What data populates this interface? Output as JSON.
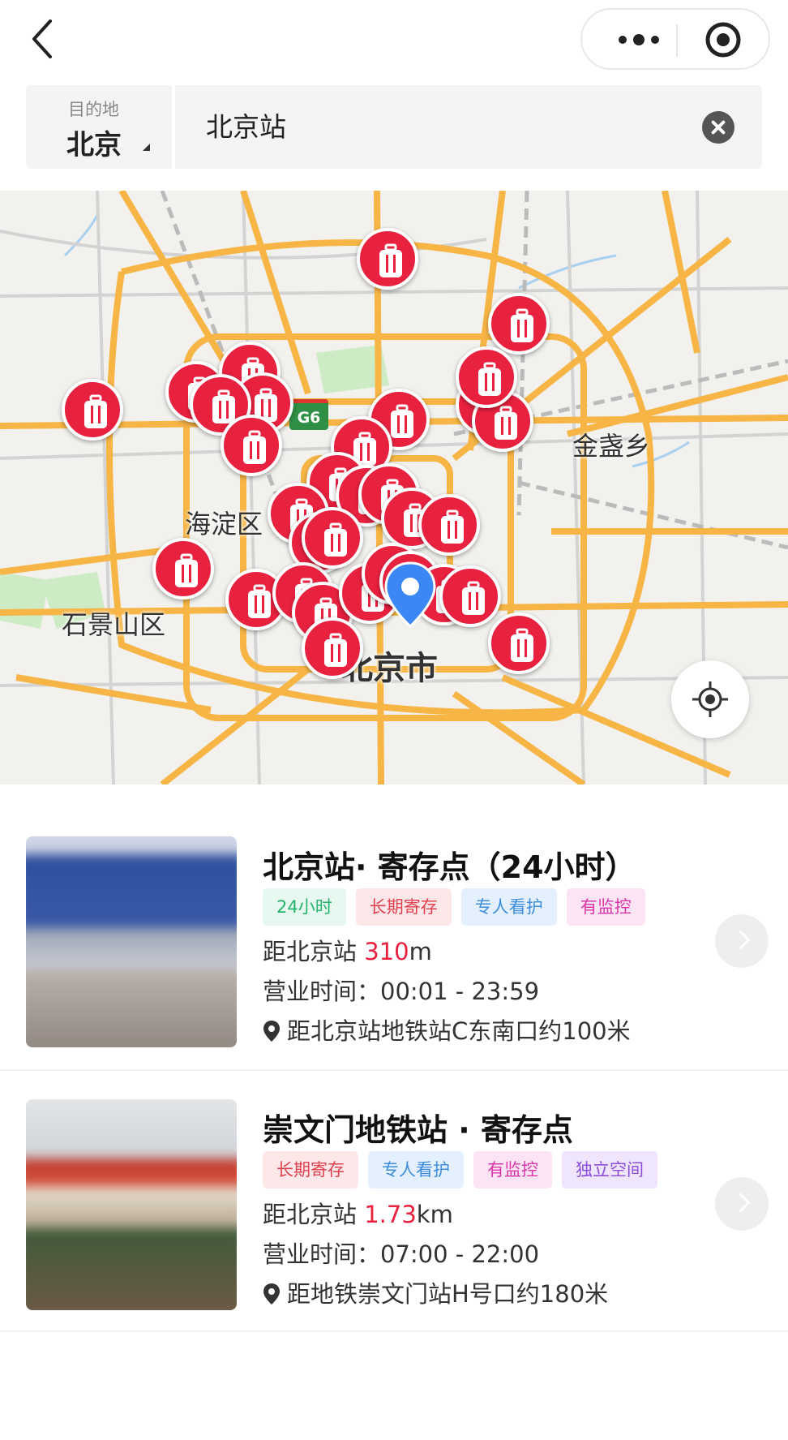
{
  "nav": {
    "back_icon": "chevron-left-icon",
    "capsule": {
      "more_icon": "more-dots-icon",
      "close_icon": "target-circle-icon"
    }
  },
  "search": {
    "city_caption": "目的地",
    "city": "北京",
    "query": "北京站",
    "clear_icon": "clear-icon"
  },
  "map": {
    "labels": {
      "jinzhanxiang": "金盏乡",
      "haidian": "海淀区",
      "shijingshan": "石景山区",
      "beijing_city": "北京市"
    },
    "highway_shield": "G6",
    "marker_icon": "luggage-icon",
    "marker_count": 32,
    "current_location_icon": "location-pin-icon",
    "locate_button_icon": "crosshair-icon",
    "colors": {
      "marker": "#e8213f",
      "pin": "#3b87f5",
      "road": "#f6b545"
    }
  },
  "results": [
    {
      "title": "北京站· 寄存点（24小时）",
      "tags": [
        {
          "label": "24小时",
          "style": "green"
        },
        {
          "label": "长期寄存",
          "style": "red"
        },
        {
          "label": "专人看护",
          "style": "blue"
        },
        {
          "label": "有监控",
          "style": "pink"
        }
      ],
      "distance_prefix": "距北京站 ",
      "distance_value": "310",
      "distance_unit": "m",
      "hours": "营业时间：00:01 - 23:59",
      "address": "距北京站地铁站C东南口约100米",
      "photo_palette": [
        "#2f4f9a",
        "#cfd3dc",
        "#8a7f79"
      ]
    },
    {
      "title": "崇文门地铁站 · 寄存点",
      "tags": [
        {
          "label": "长期寄存",
          "style": "red"
        },
        {
          "label": "专人看护",
          "style": "blue"
        },
        {
          "label": "有监控",
          "style": "pink"
        },
        {
          "label": "独立空间",
          "style": "purple"
        }
      ],
      "distance_prefix": "距北京站 ",
      "distance_value": "1.73",
      "distance_unit": "km",
      "hours": "营业时间：07:00 - 22:00",
      "address": "距地铁崇文门站H号口约180米",
      "photo_palette": [
        "#d9dce0",
        "#c0392b",
        "#5d4a38"
      ]
    }
  ]
}
